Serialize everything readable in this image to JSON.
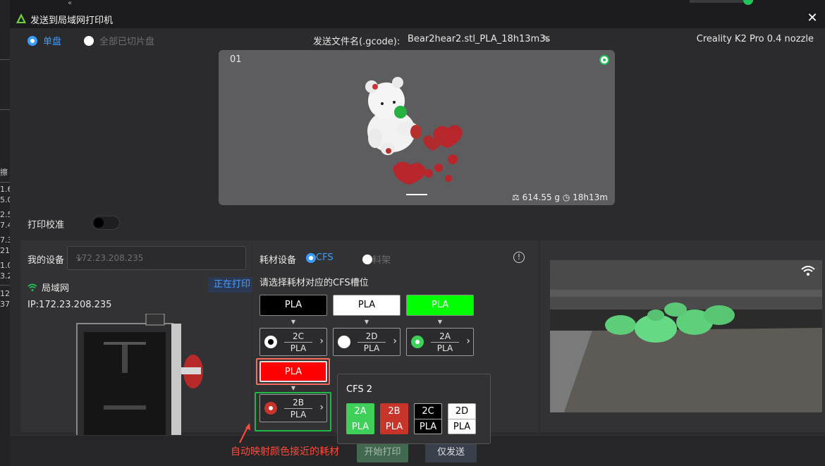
{
  "background": {
    "left_texts": [
      "擦",
      "1.6",
      "5.0",
      "2.5",
      "7.4",
      "7.3",
      "21",
      "1.0",
      "3.2",
      "12",
      "37"
    ],
    "top_icon": "double-chevron-icon"
  },
  "dialog": {
    "title": "发送到局域网打印机",
    "close_glyph": "✕"
  },
  "mode": {
    "single": "单盘",
    "all": "全部已切片盘",
    "filename_label": "发送文件名(.gcode):",
    "filename": "Bear2hear2.stl_PLA_18h13m3s",
    "edit_glyph": "✎",
    "printer_model": "Creality K2 Pro 0.4 nozzle"
  },
  "preview": {
    "plate_number": "01",
    "weight": "614.55 g",
    "time": "18h13m",
    "weight_icon": "scale-icon",
    "time_icon": "clock-icon"
  },
  "calibration": {
    "label": "打印校准",
    "enabled": false
  },
  "device": {
    "label": "我的设备",
    "selected": "172.23.208.235",
    "network": "局域网",
    "status": "正在打印",
    "ip": "IP:172.23.208.235"
  },
  "material": {
    "label": "耗材设备",
    "option_cfs": "CFS",
    "option_rack": "料架",
    "prompt": "请选择耗材对应的CFS槽位",
    "arrow": "▼",
    "filaments": [
      {
        "name": "PLA",
        "color": "#000000",
        "text_color": "#ffffff",
        "slot_id": "2C",
        "slot_mat": "PLA",
        "slot_color": "#000000"
      },
      {
        "name": "PLA",
        "color": "#ffffff",
        "text_color": "#000000",
        "slot_id": "2D",
        "slot_mat": "PLA",
        "slot_color": "#ffffff"
      },
      {
        "name": "PLA",
        "color": "#00ff00",
        "text_color": "#ffffff",
        "slot_id": "2A",
        "slot_mat": "PLA",
        "slot_color": "#3fd05a"
      },
      {
        "name": "PLA",
        "color": "#ff0000",
        "text_color": "#ffffff",
        "slot_id": "2B",
        "slot_mat": "PLA",
        "slot_color": "#c8342a"
      }
    ]
  },
  "cfs_popup": {
    "title": "CFS 2",
    "chips": [
      {
        "id": "2A",
        "mat": "PLA",
        "bg": "#3fd05a",
        "fg": "#ffffff"
      },
      {
        "id": "2B",
        "mat": "PLA",
        "bg": "#c8342a",
        "fg": "#ffffff"
      },
      {
        "id": "2C",
        "mat": "PLA",
        "bg": "#000000",
        "fg": "#ffffff"
      },
      {
        "id": "2D",
        "mat": "PLA",
        "bg": "#ffffff",
        "fg": "#000000"
      }
    ]
  },
  "actions": {
    "start": "开始打印",
    "send_only": "仅发送"
  },
  "annotation": {
    "text": "自动映射颜色接近的耗材"
  },
  "colors": {
    "accent": "#3b9cff",
    "success": "#21c45a",
    "annotation": "#ff4a3c"
  }
}
